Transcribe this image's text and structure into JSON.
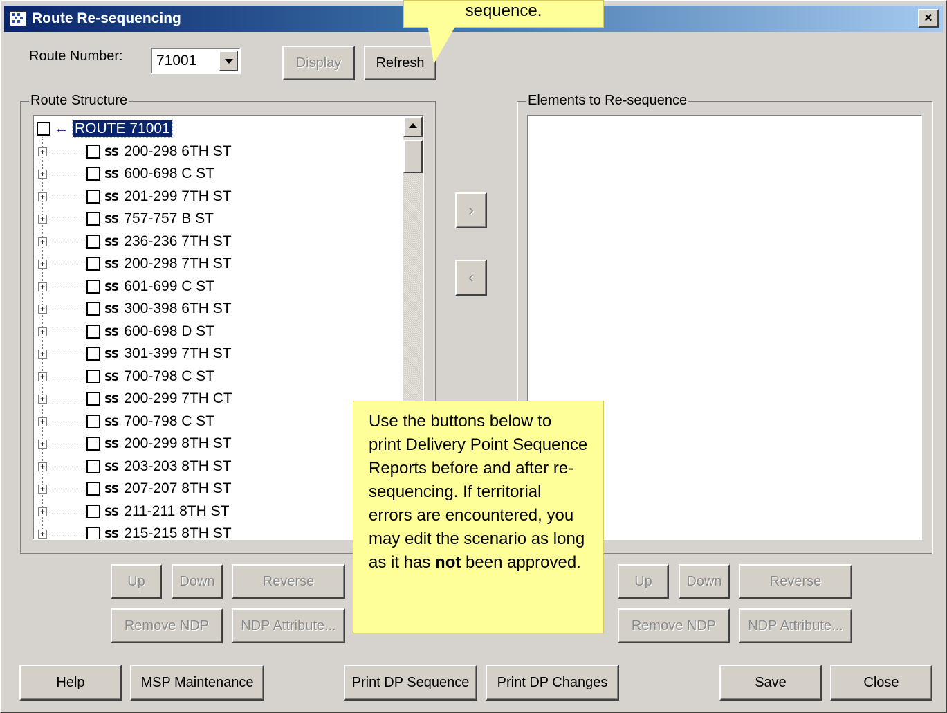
{
  "window": {
    "title": "Route Re-sequencing",
    "close_glyph": "×"
  },
  "route": {
    "label": "Route Number:",
    "value": "71001"
  },
  "top_buttons": {
    "display": "Display",
    "refresh": "Refresh"
  },
  "callout_top": {
    "text": "sequence."
  },
  "route_structure": {
    "title": "Route Structure",
    "root": "ROUTE 71001",
    "ss_glyph": "SS",
    "rows": [
      "200-298 6TH ST",
      "600-698 C ST",
      "201-299 7TH ST",
      "757-757 B ST",
      "236-236 7TH ST",
      "200-298 7TH ST",
      "601-699 C ST",
      "300-398 6TH ST",
      "600-698 D ST",
      "301-399 7TH ST",
      "700-798 C ST",
      "200-299 7TH CT",
      "700-798 C ST",
      "200-299 8TH ST",
      "203-203 8TH ST",
      "207-207 8TH ST",
      "211-211 8TH ST",
      "215-215 8TH ST"
    ]
  },
  "transfer": {
    "add": "›",
    "remove": "‹"
  },
  "elements": {
    "title": "Elements to Re-sequence"
  },
  "left_controls": {
    "up": "Up",
    "down": "Down",
    "reverse": "Reverse",
    "remove_ndp": "Remove NDP",
    "ndp_attribute": "NDP Attribute..."
  },
  "right_controls": {
    "up": "Up",
    "down": "Down",
    "reverse": "Reverse",
    "remove_ndp": "Remove NDP",
    "ndp_attribute": "NDP Attribute..."
  },
  "callout_mid": {
    "text_before": "Use the buttons below to print Delivery Point Sequence Reports before and after re-sequencing.  If territorial errors are encountered, you may edit the scenario as long as it has ",
    "bold": "not",
    "text_after": " been approved."
  },
  "bottom_buttons": {
    "help": "Help",
    "msp": "MSP Maintenance",
    "print_seq": "Print DP Sequence",
    "print_changes": "Print DP Changes",
    "save": "Save",
    "close": "Close"
  }
}
